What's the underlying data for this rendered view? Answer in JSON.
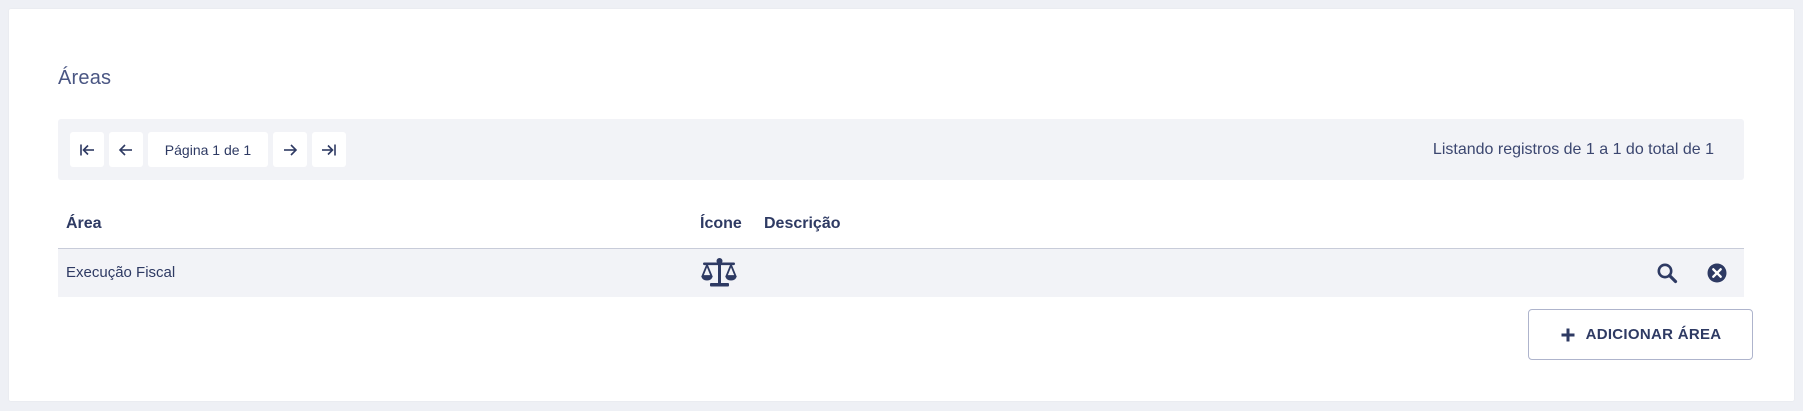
{
  "page": {
    "title": "Áreas"
  },
  "pagination": {
    "page_info": "Página 1 de 1",
    "listing_text": "Listando registros de 1 a 1 do total de 1"
  },
  "table": {
    "columns": [
      "Área",
      "Ícone",
      "Descrição"
    ],
    "rows": [
      {
        "area": "Execução Fiscal",
        "icon": "scale-balance-icon",
        "description": ""
      }
    ]
  },
  "actions": {
    "add_label": "ADICIONAR ÁREA"
  },
  "colors": {
    "primary": "#2e3a63",
    "bar_bg": "#f2f3f7"
  }
}
